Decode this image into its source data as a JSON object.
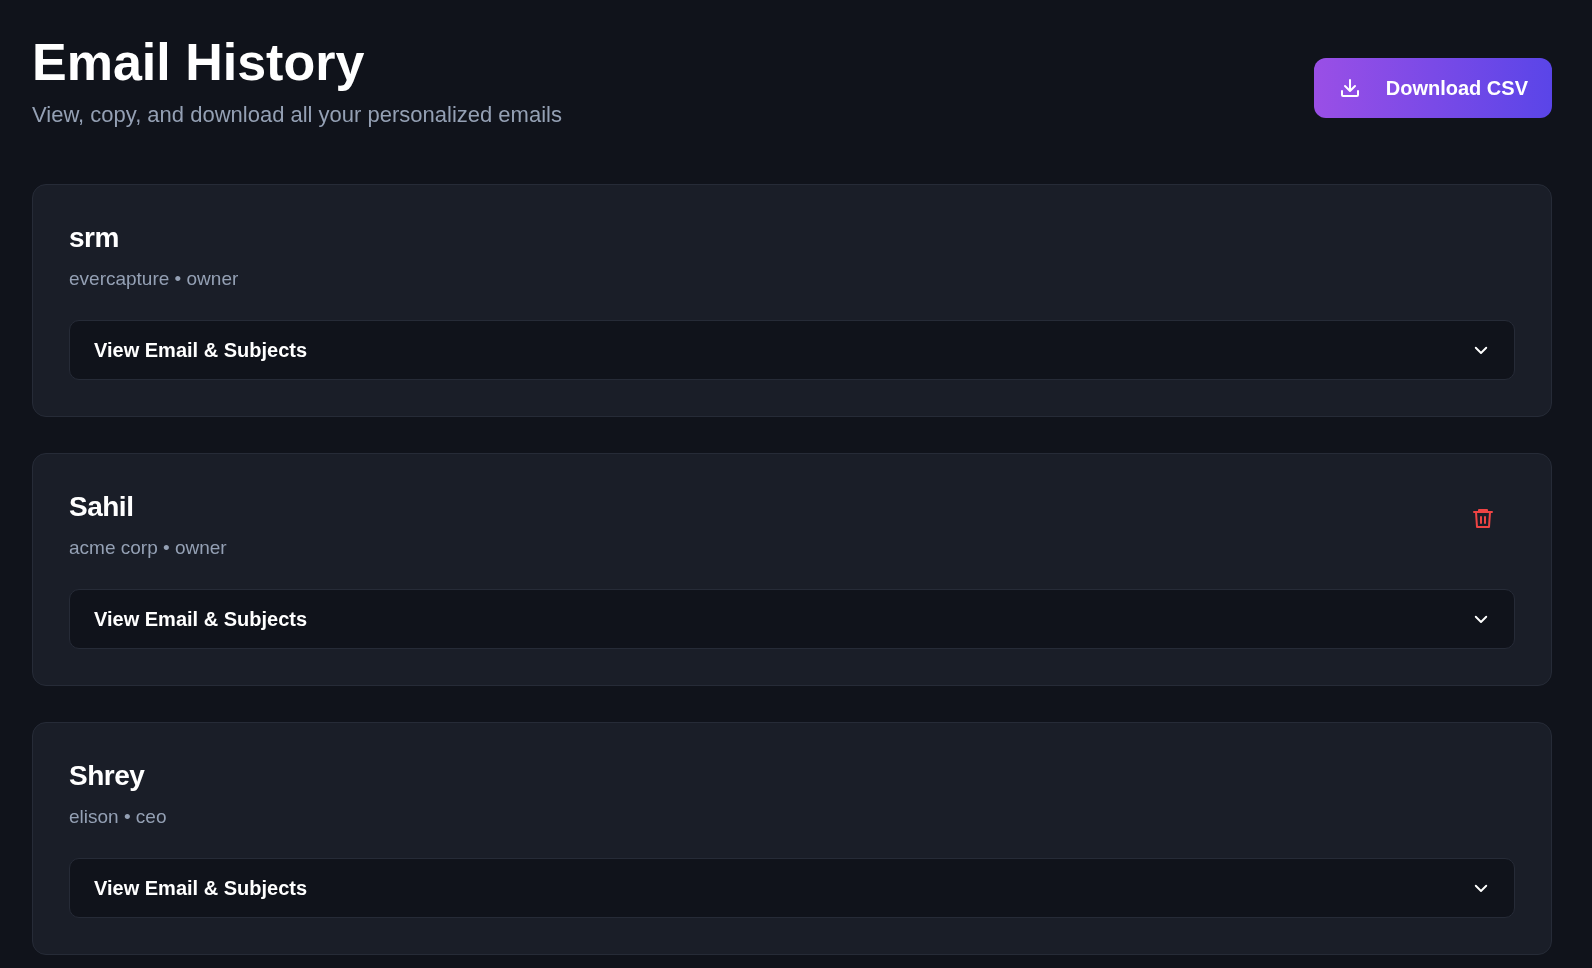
{
  "header": {
    "title": "Email History",
    "subtitle": "View, copy, and download all your personalized emails",
    "download_button": "Download CSV"
  },
  "contacts": [
    {
      "name": "srm",
      "details": "evercapture • owner",
      "toggle": "View Email & Subjects",
      "expanded": false,
      "delete_visible": false
    },
    {
      "name": "Sahil",
      "details": "acme corp • owner",
      "toggle": "View Email & Subjects",
      "expanded": false,
      "delete_visible": true
    },
    {
      "name": "Shrey",
      "details": "elison • ceo",
      "toggle": "View Email & Subjects",
      "expanded": false,
      "delete_visible": false
    }
  ]
}
